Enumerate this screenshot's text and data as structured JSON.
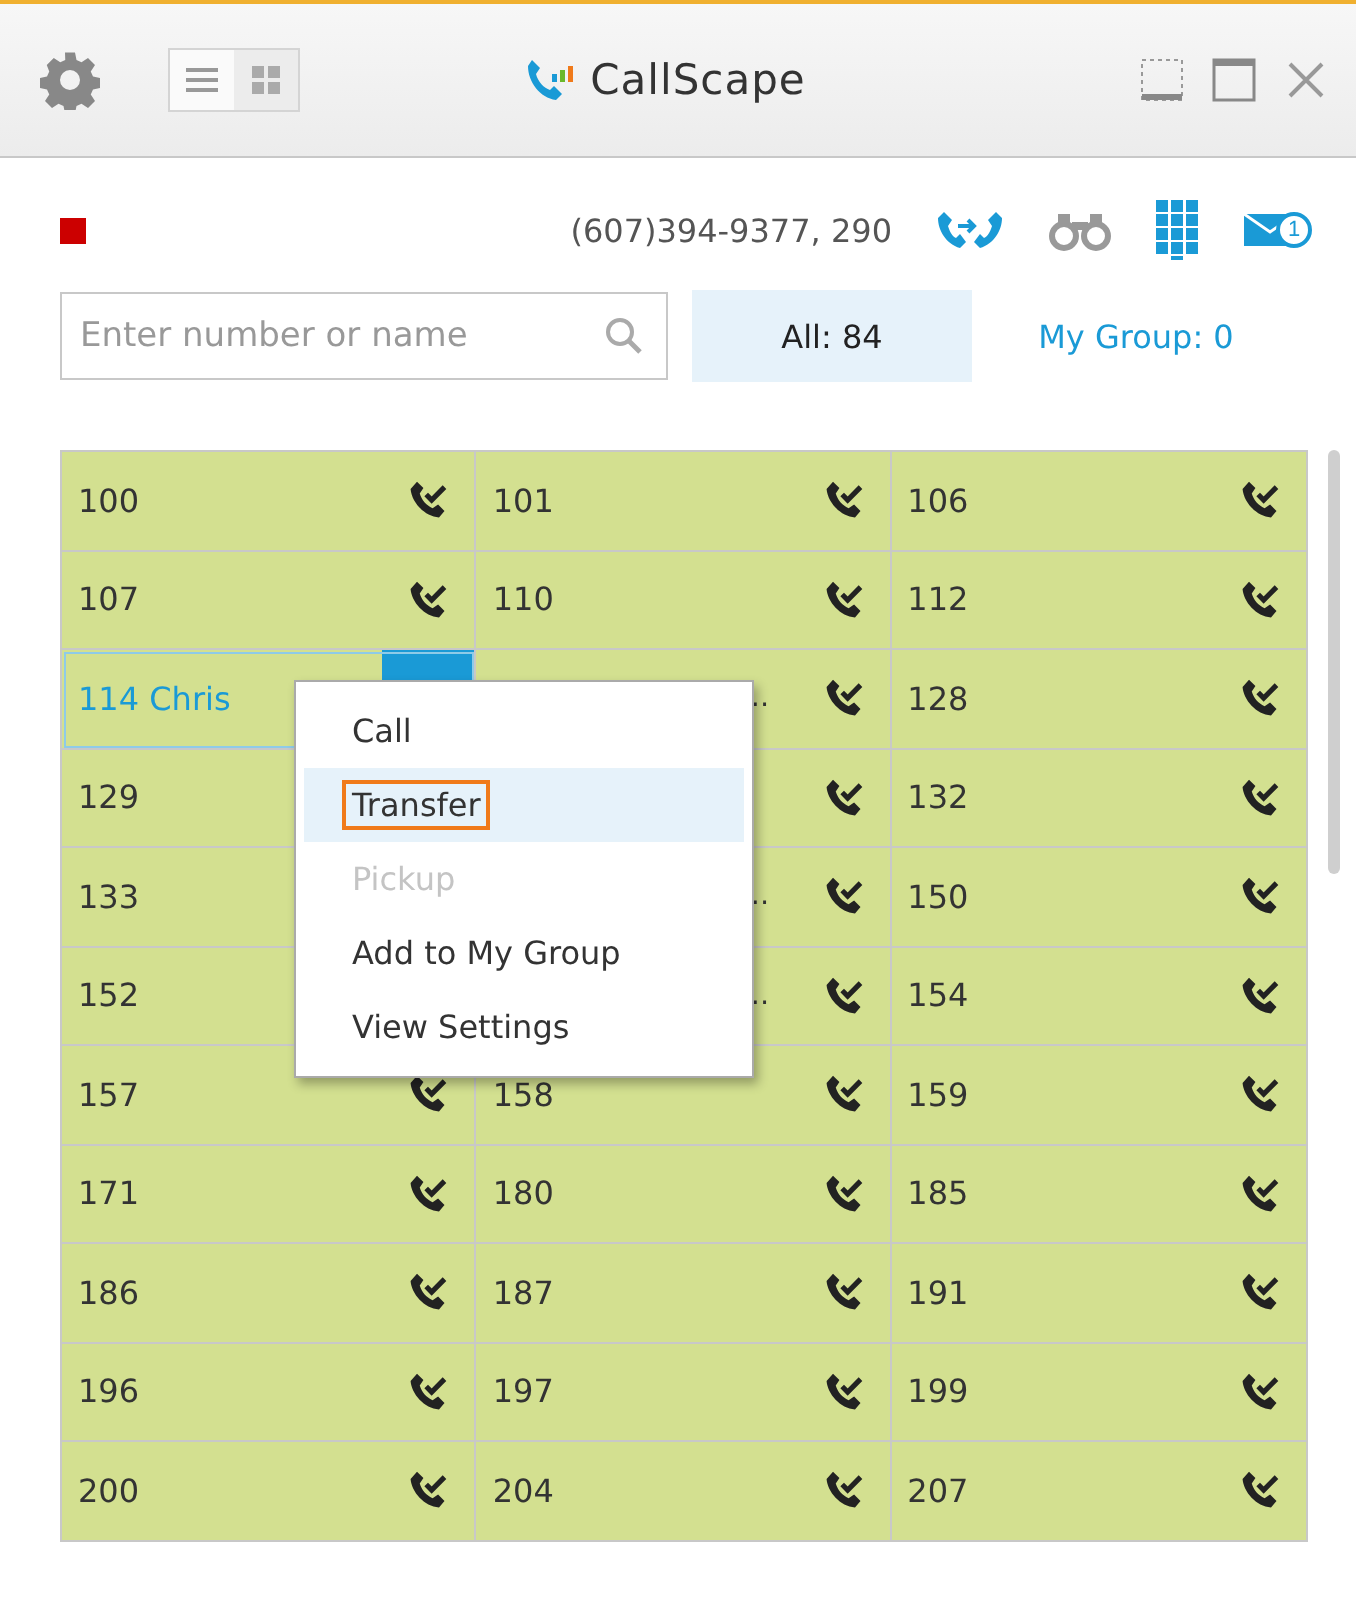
{
  "window": {
    "title": "CallScape"
  },
  "phone": "(607)394-9377",
  "extension": ", 290",
  "message_badge": "1",
  "search": {
    "placeholder": "Enter number or name"
  },
  "filters": [
    {
      "label": "All: 84",
      "selected": true
    },
    {
      "label": "My Group: 0",
      "selected": false
    }
  ],
  "grid": {
    "rows": [
      [
        {
          "label": "100",
          "selected": false
        },
        {
          "label": "101",
          "selected": false
        },
        {
          "label": "106",
          "selected": false
        }
      ],
      [
        {
          "label": "107",
          "selected": false
        },
        {
          "label": "110",
          "selected": false
        },
        {
          "label": "112",
          "selected": false
        }
      ],
      [
        {
          "label": "114 Chris",
          "selected": true,
          "call_icon": false
        },
        {
          "tail": "…",
          "selected": false
        },
        {
          "label": "128",
          "selected": false
        }
      ],
      [
        {
          "label": "129",
          "selected": false,
          "call_icon": false
        },
        {
          "selected": false
        },
        {
          "label": "132",
          "selected": false
        }
      ],
      [
        {
          "label": "133",
          "selected": false,
          "call_icon": false
        },
        {
          "tail": "…",
          "selected": false
        },
        {
          "label": "150",
          "selected": false
        }
      ],
      [
        {
          "label": "152",
          "selected": false,
          "call_icon": false
        },
        {
          "tail": "…",
          "selected": false
        },
        {
          "label": "154",
          "selected": false
        }
      ],
      [
        {
          "label": "157",
          "selected": false
        },
        {
          "label": "158",
          "selected": false
        },
        {
          "label": "159",
          "selected": false
        }
      ],
      [
        {
          "label": "171",
          "selected": false
        },
        {
          "label": "180",
          "selected": false
        },
        {
          "label": "185",
          "selected": false
        }
      ],
      [
        {
          "label": "186",
          "selected": false
        },
        {
          "label": "187",
          "selected": false
        },
        {
          "label": "191",
          "selected": false
        }
      ],
      [
        {
          "label": "196",
          "selected": false
        },
        {
          "label": "197",
          "selected": false
        },
        {
          "label": "199",
          "selected": false
        }
      ],
      [
        {
          "label": "200",
          "selected": false
        },
        {
          "label": "204",
          "selected": false
        },
        {
          "label": "207",
          "selected": false
        }
      ]
    ]
  },
  "context_menu": {
    "items": [
      {
        "label": "Call",
        "selected": false,
        "disabled": false
      },
      {
        "label": "Transfer",
        "selected": true,
        "disabled": false
      },
      {
        "label": "Pickup",
        "selected": false,
        "disabled": true
      },
      {
        "label": "Add to My Group",
        "selected": false,
        "disabled": false
      },
      {
        "label": "View Settings",
        "selected": false,
        "disabled": false
      }
    ]
  }
}
